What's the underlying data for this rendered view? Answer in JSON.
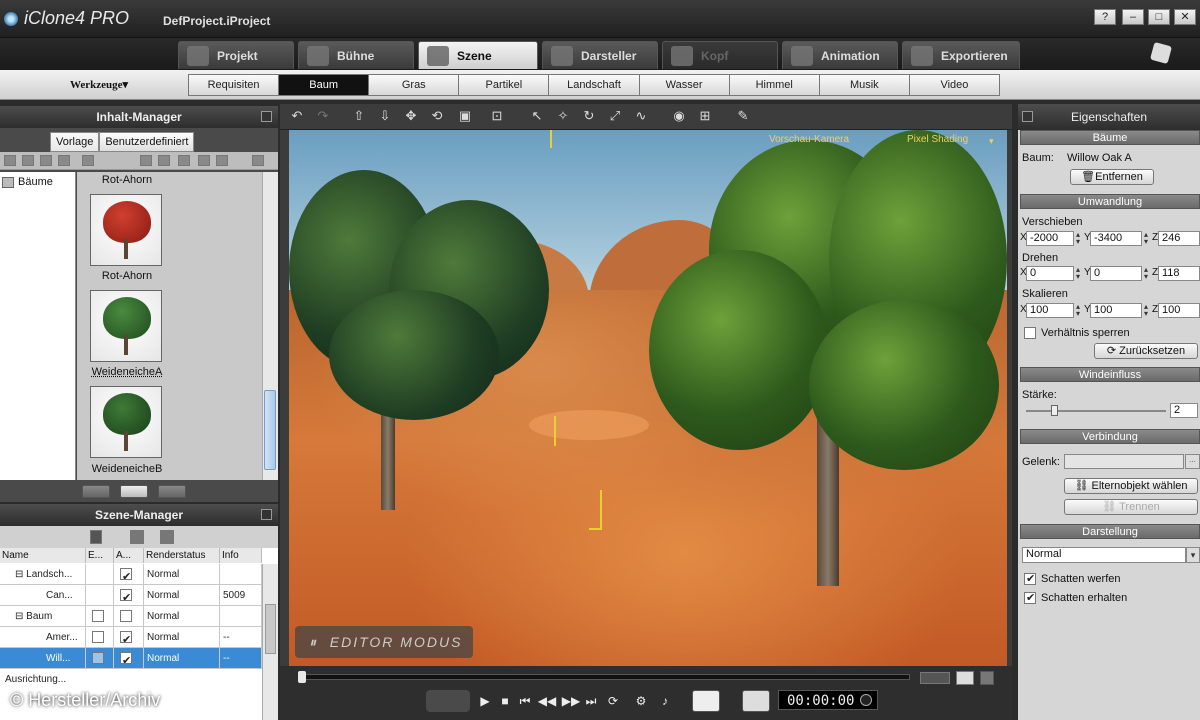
{
  "window": {
    "app_name": "iClone4 PRO",
    "project": "DefProject.iProject",
    "min": "?",
    "restore": "–",
    "maximize": "□",
    "close": "✕"
  },
  "main_tabs": [
    {
      "label": "Projekt",
      "state": "normal"
    },
    {
      "label": "Bühne",
      "state": "normal"
    },
    {
      "label": "Szene",
      "state": "active"
    },
    {
      "label": "Darsteller",
      "state": "normal"
    },
    {
      "label": "Kopf",
      "state": "disabled"
    },
    {
      "label": "Animation",
      "state": "normal"
    },
    {
      "label": "Exportieren",
      "state": "normal"
    }
  ],
  "sub_bar": {
    "tools_label": "Werkzeuge▾",
    "tabs": [
      "Requisiten",
      "Baum",
      "Gras",
      "Partikel",
      "Landschaft",
      "Wasser",
      "Himmel",
      "Musik",
      "Video"
    ],
    "active": "Baum"
  },
  "content_manager": {
    "title": "Inhalt-Manager",
    "tabs": [
      "Vorlage",
      "Benutzerdefiniert"
    ],
    "tree_item": "Bäume",
    "top_label": "Rot-Ahorn",
    "items": [
      {
        "name": "Rot-Ahorn",
        "color": "#b02a1e"
      },
      {
        "name": "WeideneicheA",
        "color": "#2f6a2a"
      },
      {
        "name": "WeideneicheB",
        "color": "#2a5e28"
      }
    ]
  },
  "scene_manager": {
    "title": "Szene-Manager",
    "columns": [
      "Name",
      "E...",
      "A...",
      "Renderstatus",
      "Info"
    ],
    "rows": [
      {
        "name": "⊟ Landsch...",
        "e": false,
        "a": true,
        "status": "Normal",
        "info": "",
        "selected": false
      },
      {
        "name": "Can...",
        "e": false,
        "a": true,
        "status": "Normal",
        "info": "5009",
        "selected": false
      },
      {
        "name": "⊟ Baum",
        "e": false,
        "a": false,
        "status": "Normal",
        "info": "",
        "selected": false
      },
      {
        "name": "Amer...",
        "e": false,
        "a": true,
        "status": "Normal",
        "info": "--",
        "selected": false
      },
      {
        "name": "Will...",
        "e": false,
        "a": true,
        "status": "Normal",
        "info": "--",
        "selected": true
      },
      {
        "name": "Ausrichtung...",
        "e": false,
        "a": false,
        "status": "",
        "info": "",
        "selected": false
      }
    ]
  },
  "viewport": {
    "camera": "Vorschau-Kamera",
    "shading": "Pixel Shading",
    "mode": "EDITOR MODUS"
  },
  "timeline": {
    "time": "00:00:00",
    "progress": 0.0
  },
  "properties": {
    "title": "Eigenschaften",
    "section_trees": "Bäume",
    "tree_label": "Baum:",
    "tree_value": "Willow Oak A",
    "remove_btn": "Entfernen",
    "section_transform": "Umwandlung",
    "move_label": "Verschieben",
    "move": {
      "x": "-2000",
      "y": "-3400",
      "z": "246"
    },
    "rotate_label": "Drehen",
    "rotate": {
      "x": "0",
      "y": "0",
      "z": "118"
    },
    "scale_label": "Skalieren",
    "scale": {
      "x": "100",
      "y": "100",
      "z": "100"
    },
    "lock_ratio": "Verhältnis sperren",
    "reset_btn": "Zurücksetzen",
    "section_wind": "Windeinfluss",
    "strength_label": "Stärke:",
    "strength_value": "2",
    "strength_level": 0.2,
    "section_link": "Verbindung",
    "joint_label": "Gelenk:",
    "parent_btn": "Elternobjekt wählen",
    "detach_btn": "Trennen",
    "section_display": "Darstellung",
    "display_value": "Normal",
    "cast_shadow": "Schatten werfen",
    "receive_shadow": "Schatten erhalten"
  },
  "watermark": "© Hersteller/Archiv"
}
